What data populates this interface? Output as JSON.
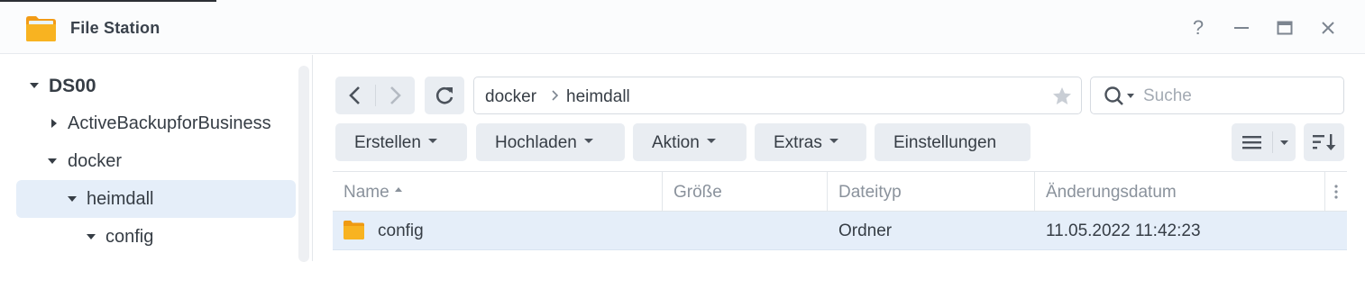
{
  "window": {
    "title": "File Station",
    "help_label": "?",
    "close_label": "✕"
  },
  "sidebar": {
    "root": "DS00",
    "items": [
      {
        "label": "ActiveBackupforBusiness"
      },
      {
        "label": "docker"
      },
      {
        "label": "heimdall"
      },
      {
        "label": "config"
      }
    ]
  },
  "toolbar": {
    "buttons": [
      {
        "label": "Erstellen"
      },
      {
        "label": "Hochladen"
      },
      {
        "label": "Aktion"
      },
      {
        "label": "Extras"
      },
      {
        "label": "Einstellungen"
      }
    ]
  },
  "path": {
    "segments": [
      "docker",
      "heimdall"
    ]
  },
  "search": {
    "placeholder": "Suche",
    "value": ""
  },
  "table": {
    "columns": [
      "Name",
      "Größe",
      "Dateityp",
      "Änderungsdatum"
    ],
    "rows": [
      {
        "name": "config",
        "size": "",
        "type": "Ordner",
        "modified": "11.05.2022 11:42:23"
      }
    ]
  },
  "colors": {
    "accent_selection": "#e5eef9",
    "folder": "#f5a623",
    "button_bg": "#e9edf2"
  }
}
